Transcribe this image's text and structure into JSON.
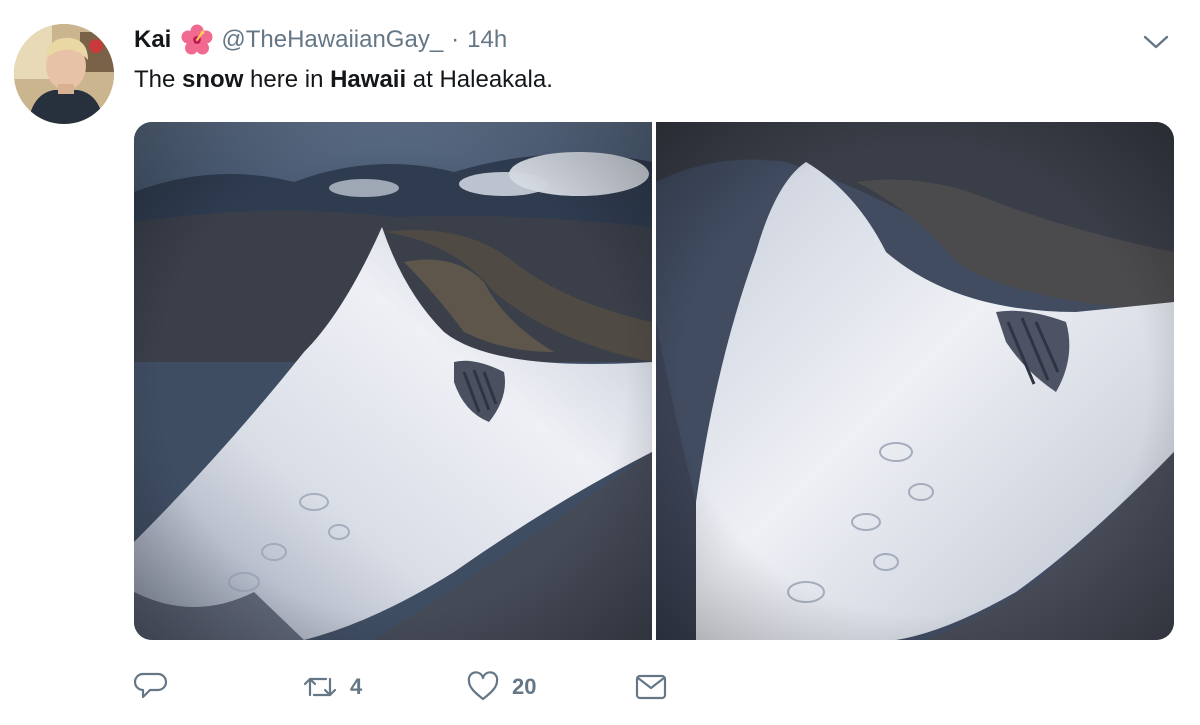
{
  "tweet": {
    "author": {
      "display_name": "Kai",
      "handle": "@TheHawaiianGay_",
      "badge_icon": "hibiscus-icon"
    },
    "separator": "·",
    "timestamp": "14h",
    "text": {
      "part1": "The ",
      "bold1": "snow",
      "part2": " here in ",
      "bold2": "Hawaii",
      "part3": " at Haleakala."
    },
    "media": [
      {
        "kind": "photo",
        "subject": "snow-covered summit, aerial view"
      },
      {
        "kind": "photo",
        "subject": "snow-covered summit, closer aerial view"
      }
    ],
    "actions": {
      "reply": {
        "icon": "reply-icon",
        "count": ""
      },
      "retweet": {
        "icon": "retweet-icon",
        "count": "4"
      },
      "like": {
        "icon": "heart-icon",
        "count": "20"
      },
      "message": {
        "icon": "envelope-icon"
      }
    }
  },
  "colors": {
    "text_primary": "#14171a",
    "text_secondary": "#657786",
    "background": "#ffffff"
  }
}
